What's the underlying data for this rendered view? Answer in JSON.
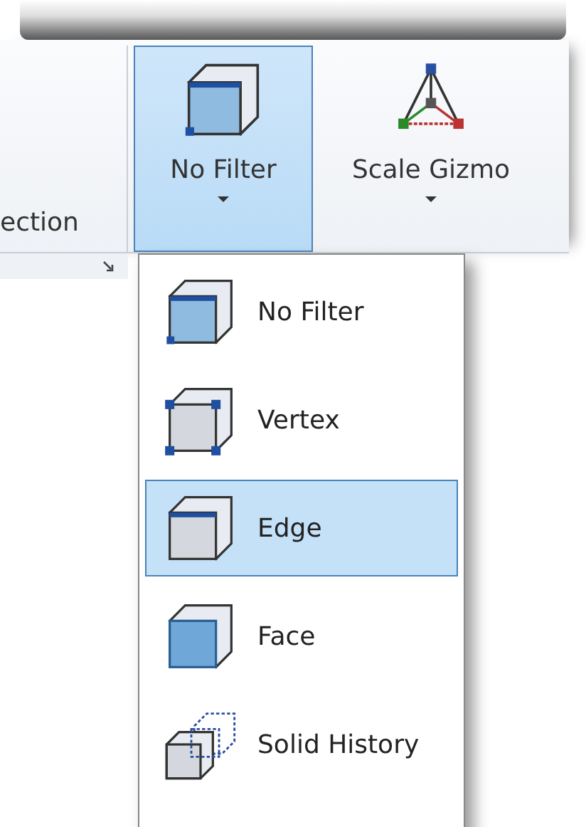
{
  "ribbon": {
    "section_label": "ection",
    "buttons": [
      {
        "label": "No Filter",
        "kind": "filter",
        "selected": true
      },
      {
        "label": "Scale Gizmo",
        "kind": "gizmo",
        "selected": false
      }
    ]
  },
  "menu": {
    "items": [
      {
        "label": "No Filter",
        "kind": "none",
        "selected": false
      },
      {
        "label": "Vertex",
        "kind": "vertex",
        "selected": false
      },
      {
        "label": "Edge",
        "kind": "edge",
        "selected": true
      },
      {
        "label": "Face",
        "kind": "face",
        "selected": false
      },
      {
        "label": "Solid History",
        "kind": "history",
        "selected": false
      }
    ]
  }
}
